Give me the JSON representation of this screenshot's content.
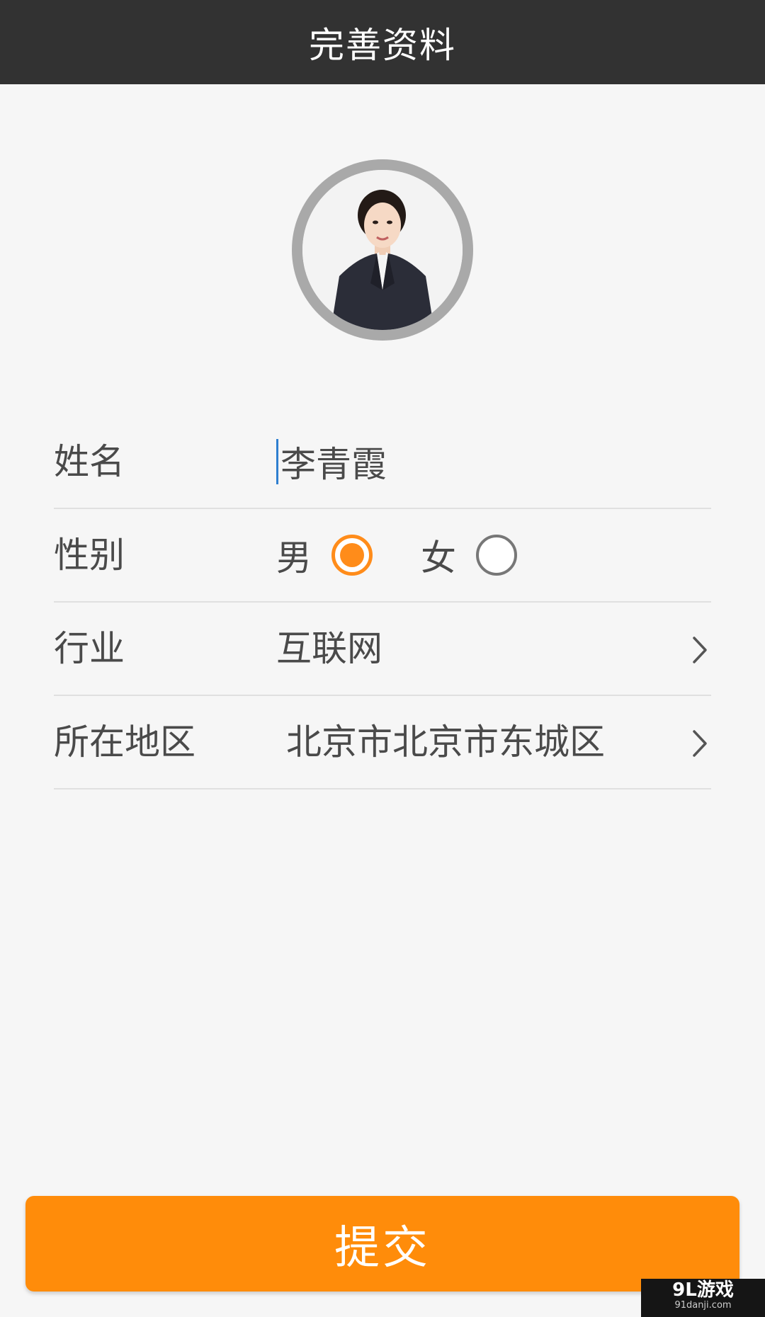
{
  "header": {
    "title": "完善资料"
  },
  "profile": {
    "avatar_alt": "头像"
  },
  "form": {
    "name_label": "姓名",
    "name_value": "李青霞",
    "gender_label": "性别",
    "gender_options": [
      {
        "label": "男",
        "selected": true
      },
      {
        "label": "女",
        "selected": false
      }
    ],
    "industry_label": "行业",
    "industry_value": "互联网",
    "region_label": "所在地区",
    "region_value": "北京市北京市东城区"
  },
  "submit": {
    "label": "提交"
  },
  "watermark": {
    "brand": "9L游戏",
    "url": "91danji.com"
  },
  "colors": {
    "accent": "#ff8c0a",
    "titlebar": "#323232",
    "background": "#f6f6f6"
  }
}
